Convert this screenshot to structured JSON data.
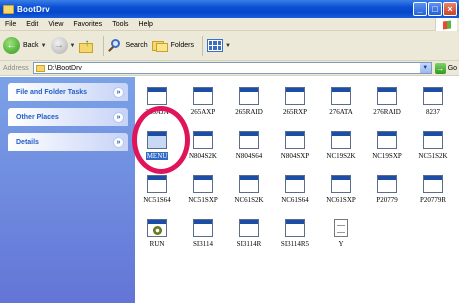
{
  "window": {
    "title": "BootDrv",
    "buttons": {
      "minimize": "_",
      "maximize": "□",
      "close": "×"
    }
  },
  "menu": [
    "File",
    "Edit",
    "View",
    "Favorites",
    "Tools",
    "Help"
  ],
  "toolbar": {
    "back_label": "Back",
    "search_label": "Search",
    "folders_label": "Folders"
  },
  "address": {
    "label": "Address",
    "value": "D:\\BootDrv",
    "go_label": "Go"
  },
  "left_pane": {
    "panels": [
      "File and Folder Tasks",
      "Other Places",
      "Details"
    ]
  },
  "files": [
    {
      "name": "265AJA",
      "icon": "window-app-icon"
    },
    {
      "name": "265AXP",
      "icon": "window-app-icon"
    },
    {
      "name": "265RAID",
      "icon": "window-app-icon"
    },
    {
      "name": "265RXP",
      "icon": "window-app-icon"
    },
    {
      "name": "276ATA",
      "icon": "window-app-icon"
    },
    {
      "name": "276RAID",
      "icon": "window-app-icon"
    },
    {
      "name": "8237",
      "icon": "window-app-icon"
    },
    {
      "name": "MENU",
      "icon": "window-app-icon",
      "selected": true
    },
    {
      "name": "N804S2K",
      "icon": "window-app-icon"
    },
    {
      "name": "N804S64",
      "icon": "window-app-icon"
    },
    {
      "name": "N804SXP",
      "icon": "window-app-icon"
    },
    {
      "name": "NC19S2K",
      "icon": "window-app-icon"
    },
    {
      "name": "NC19SXP",
      "icon": "window-app-icon"
    },
    {
      "name": "NC51S2K",
      "icon": "window-app-icon"
    },
    {
      "name": "NC51S64",
      "icon": "window-app-icon"
    },
    {
      "name": "NC51SXP",
      "icon": "window-app-icon"
    },
    {
      "name": "NC61S2K",
      "icon": "window-app-icon"
    },
    {
      "name": "NC61S64",
      "icon": "window-app-icon"
    },
    {
      "name": "NC61SXP",
      "icon": "window-app-icon"
    },
    {
      "name": "P20779",
      "icon": "window-app-icon"
    },
    {
      "name": "P20779R",
      "icon": "window-app-icon"
    },
    {
      "name": "RUN",
      "icon": "gear-app-icon"
    },
    {
      "name": "SI3114",
      "icon": "window-app-icon"
    },
    {
      "name": "SI3114R",
      "icon": "window-app-icon"
    },
    {
      "name": "SI3114R5",
      "icon": "window-app-icon"
    },
    {
      "name": "Y",
      "icon": "document-icon"
    }
  ],
  "colors": {
    "titlebar": "#0a4fd4",
    "taskpane": "#6f8fdf",
    "selection": "#316ac5",
    "highlight_ring": "#e0145a"
  }
}
